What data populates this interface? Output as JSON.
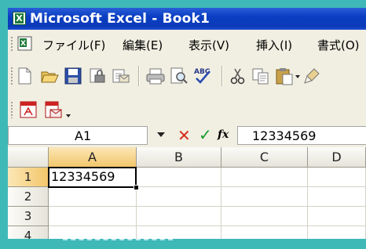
{
  "window": {
    "title": "Microsoft Excel - Book1",
    "app_icon_letter": "X"
  },
  "menu": {
    "items": [
      "ファイル(F)",
      "編集(E)",
      "表示(V)",
      "挿入(I)",
      "書式(O)"
    ]
  },
  "toolbar_standard": {
    "icons": [
      "new-icon",
      "open-icon",
      "save-icon",
      "permission-icon",
      "email-icon",
      "print-icon",
      "print-preview-icon",
      "spelling-icon",
      "cut-icon",
      "copy-icon",
      "paste-icon",
      "paste-dropdown-icon",
      "format-painter-icon"
    ]
  },
  "toolbar_pdf": {
    "icons": [
      "pdf-create-icon",
      "pdf-email-icon",
      "dropdown-icon"
    ]
  },
  "formula_bar": {
    "name_box": "A1",
    "cancel_icon": "cancel-icon",
    "enter_icon": "enter-icon",
    "fx_label": "fx",
    "content": "12334569"
  },
  "sheet": {
    "columns": [
      "A",
      "B",
      "C",
      "D"
    ],
    "rows": [
      "1",
      "2",
      "3",
      "4"
    ],
    "active_cell": "A1",
    "cells": {
      "A1": "12334569"
    }
  },
  "colors": {
    "titlebar": "#0a3dc2",
    "selection_header": "#f3c66b",
    "background": "#3fb9b8"
  }
}
